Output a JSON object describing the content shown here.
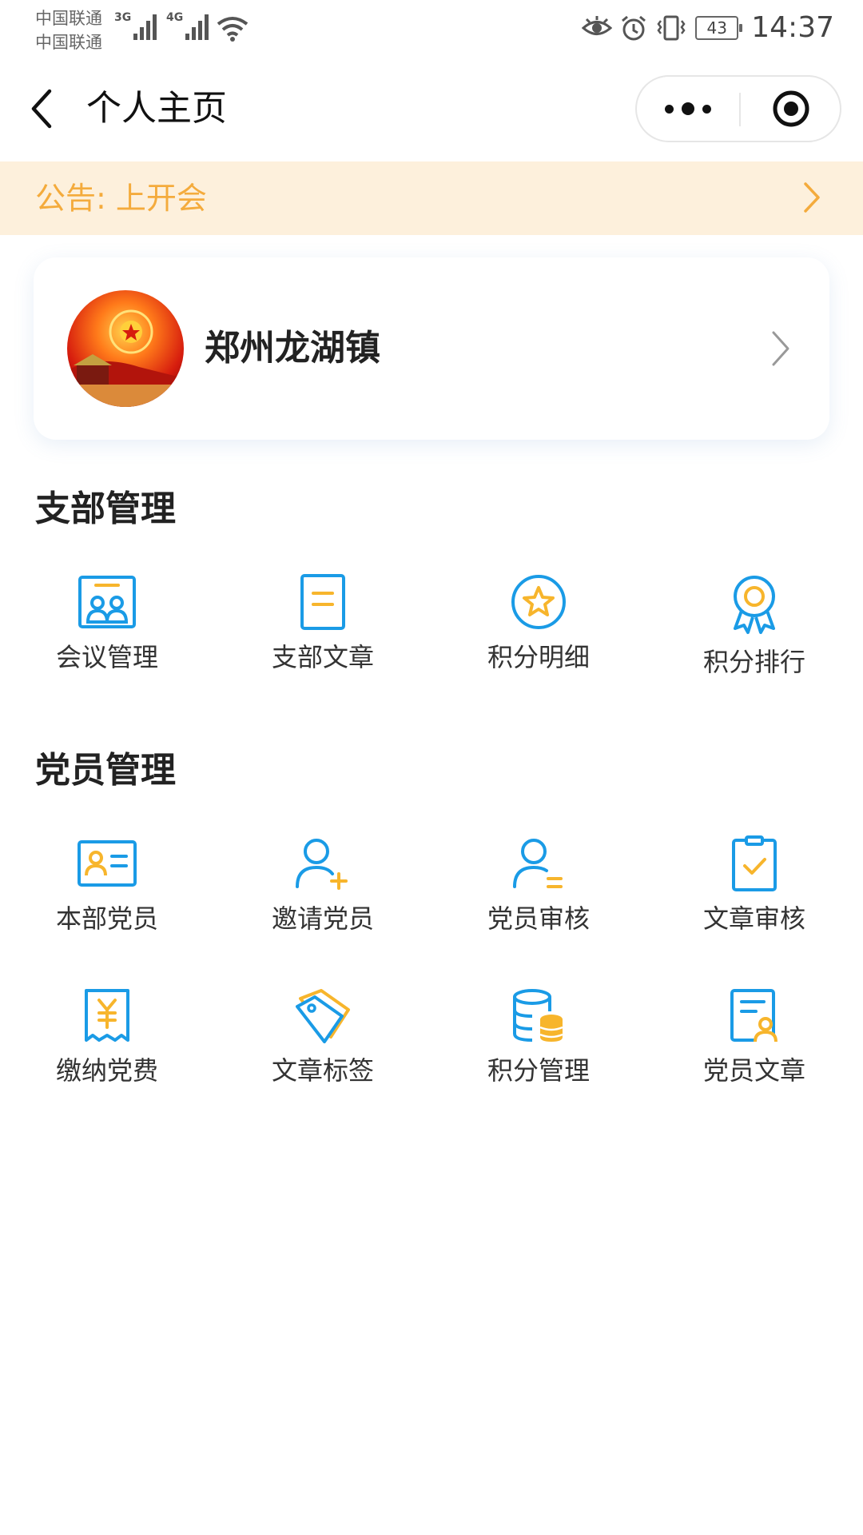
{
  "status_bar": {
    "carrier_1": "中国联通",
    "carrier_2": "中国联通",
    "network_1": "3G",
    "network_2": "4G",
    "battery": "43",
    "time": "14:37",
    "icons": [
      "eye-icon",
      "alarm-icon",
      "vibrate-icon",
      "wifi-icon",
      "battery-icon"
    ]
  },
  "nav": {
    "title": "个人主页",
    "icons": [
      "back-arrow-icon",
      "more-dots-icon",
      "close-target-icon"
    ]
  },
  "notice": {
    "text": "公告: 上开会"
  },
  "org": {
    "name": "郑州龙湖镇"
  },
  "sections": [
    {
      "title": "支部管理",
      "items": [
        {
          "label": "会议管理",
          "icon": "meeting-icon"
        },
        {
          "label": "支部文章",
          "icon": "document-icon"
        },
        {
          "label": "积分明细",
          "icon": "star-circle-icon"
        },
        {
          "label": "积分排行",
          "icon": "award-ribbon-icon"
        }
      ]
    },
    {
      "title": "党员管理",
      "items": [
        {
          "label": "本部党员",
          "icon": "id-card-icon"
        },
        {
          "label": "邀请党员",
          "icon": "add-user-icon"
        },
        {
          "label": "党员审核",
          "icon": "user-review-icon"
        },
        {
          "label": "文章审核",
          "icon": "clipboard-check-icon"
        },
        {
          "label": "缴纳党费",
          "icon": "yuan-receipt-icon"
        },
        {
          "label": "文章标签",
          "icon": "tag-icon"
        },
        {
          "label": "积分管理",
          "icon": "database-coins-icon"
        },
        {
          "label": "党员文章",
          "icon": "user-document-icon"
        }
      ]
    }
  ],
  "colors": {
    "icon_blue": "#1a9be6",
    "icon_yellow": "#f7b52c",
    "notice_bg": "#fdf0dc",
    "notice_text": "#f4ab3c"
  }
}
